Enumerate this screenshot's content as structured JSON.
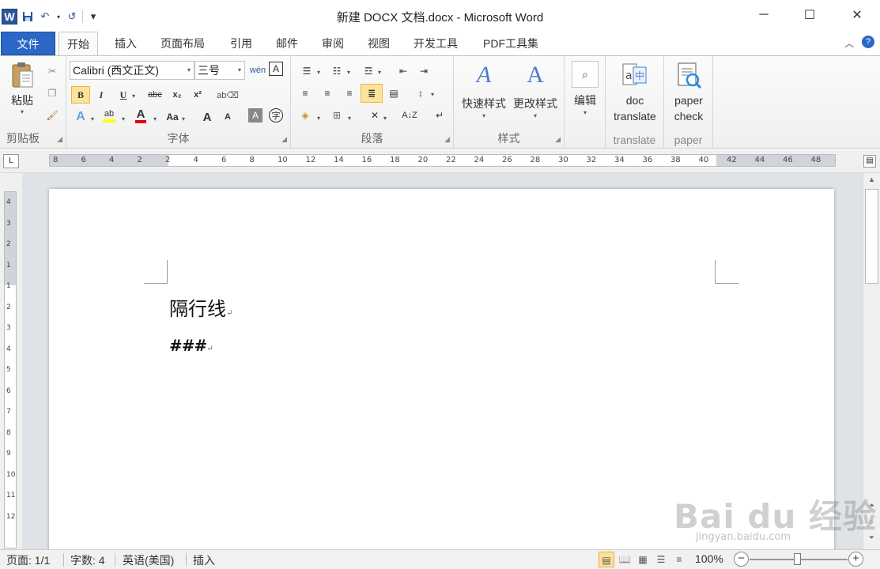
{
  "window": {
    "title": "新建 DOCX 文档.docx - Microsoft Word",
    "app_logo": "W",
    "minimize": "─",
    "maximize": "☐",
    "close": "✕"
  },
  "qat": {
    "save": "💾",
    "undo": "↶",
    "redo": "↺",
    "customize": "▾"
  },
  "tabs": [
    "文件",
    "开始",
    "插入",
    "页面布局",
    "引用",
    "邮件",
    "审阅",
    "视图",
    "开发工具",
    "PDF工具集"
  ],
  "active_tab": "开始",
  "ribbon": {
    "clipboard": {
      "label": "剪贴板",
      "paste": "粘贴"
    },
    "font": {
      "label": "字体",
      "font_name": "Calibri (西文正文)",
      "font_size": "三号",
      "bold": "B",
      "italic": "I",
      "underline": "U",
      "strike": "abc",
      "subscript": "x₂",
      "superscript": "x²",
      "grow": "A",
      "shrink": "A",
      "case": "Aa",
      "highlight_color": "#ffff00",
      "font_color": "#e00000"
    },
    "paragraph": {
      "label": "段落"
    },
    "styles": {
      "label": "样式",
      "quick_styles": "快速样式",
      "change_styles": "更改样式"
    },
    "editing": {
      "label": "编辑"
    },
    "translate": {
      "label": "translate",
      "btn_line1": "doc",
      "btn_line2": "translate"
    },
    "paper": {
      "label": "paper",
      "btn_line1": "paper",
      "btn_line2": "check"
    }
  },
  "ruler": {
    "h_ticks": [
      "8",
      "6",
      "4",
      "2",
      "2",
      "4",
      "6",
      "8",
      "10",
      "12",
      "14",
      "16",
      "18",
      "20",
      "22",
      "24",
      "26",
      "28",
      "30",
      "32",
      "34",
      "36",
      "38",
      "40",
      "42",
      "44",
      "46",
      "48"
    ],
    "v_ticks": [
      "4",
      "3",
      "2",
      "1",
      "1",
      "2",
      "3",
      "4",
      "5",
      "6",
      "7",
      "8",
      "9",
      "10",
      "11",
      "12"
    ]
  },
  "document": {
    "paragraphs": [
      "隔行线",
      "###"
    ],
    "para_mark": "↵"
  },
  "status": {
    "page": "页面: 1/1",
    "words": "字数: 4",
    "language": "英语(美国)",
    "mode": "插入",
    "zoom": "100%",
    "zoom_minus": "−",
    "zoom_plus": "+"
  },
  "watermark": {
    "main": "Bai du 经验",
    "sub": "jingyan.baidu.com"
  }
}
